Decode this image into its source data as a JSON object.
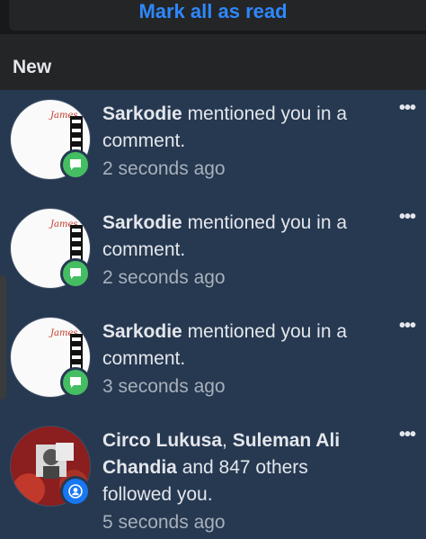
{
  "header": {
    "mark_all_read": "Mark all as read"
  },
  "section": {
    "title": "New"
  },
  "notifications": [
    {
      "actor": "Sarkodie",
      "message": "mentioned you in a comment.",
      "time": "2 seconds ago",
      "badge_icon": "comment-icon",
      "badge_color": "#45bd62"
    },
    {
      "actor": "Sarkodie",
      "message": "mentioned you in a comment.",
      "time": "2 seconds ago",
      "badge_icon": "comment-icon",
      "badge_color": "#45bd62"
    },
    {
      "actor": "Sarkodie",
      "message": "mentioned you in a comment.",
      "time": "3 seconds ago",
      "badge_icon": "comment-icon",
      "badge_color": "#45bd62"
    },
    {
      "actor": "Circo Lukusa",
      "separator": ", ",
      "actor2": "Suleman Ali Chandia",
      "message": "and 847 others followed you.",
      "time": "5 seconds ago",
      "badge_icon": "person-icon",
      "badge_color": "#1877f2"
    }
  ],
  "more_icon": "•••",
  "avatar_script_text": "James"
}
